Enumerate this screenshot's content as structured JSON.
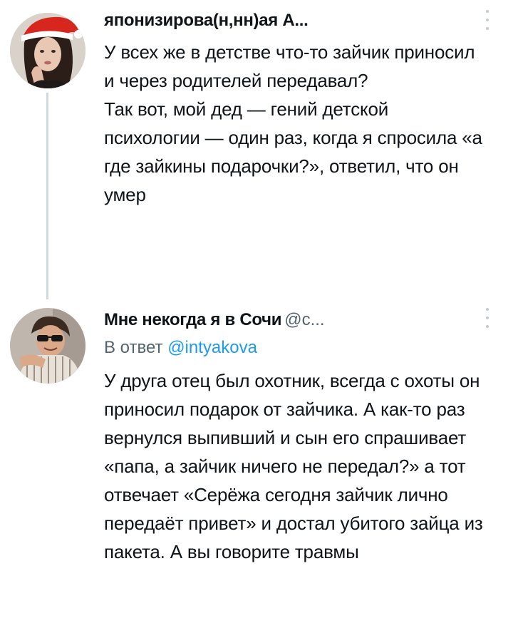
{
  "tweets": [
    {
      "display_name": "японизирова(н,нн)ая А...",
      "handle": "",
      "reply_to_prefix": "",
      "reply_to_handle": "",
      "paragraphs": [
        "У всех же в детстве что-то зайчик приносил и через родителей передавал?",
        "Так вот, мой дед — гений детской психологии — один раз, когда я спросила «а где зайкины подарочки?», ответил, что он умер"
      ],
      "avatar_icon": "santa-hat-avatar-icon"
    },
    {
      "display_name": "Мне некогда я в Сочи",
      "handle": "@с...",
      "reply_to_prefix": "В ответ",
      "reply_to_handle": "@intyakova",
      "paragraphs": [
        "У друга отец был охотник, всегда с охоты он приносил подарок от зайчика. А как-то раз вернулся выпивший и сын его спрашивает «папа, а зайчик ничего не передал?» а тот отвечает «Серёжа сегодня зайчик лично передаёт привет» и достал убитого зайца из пакета. А вы говорите травмы"
      ],
      "avatar_icon": "sunglasses-man-avatar-icon"
    }
  ],
  "colors": {
    "text": "#0f1419",
    "secondary": "#536471",
    "link": "#1d9bf0",
    "thread_line": "#cfd9de",
    "santa_hat": "#d7261e"
  }
}
